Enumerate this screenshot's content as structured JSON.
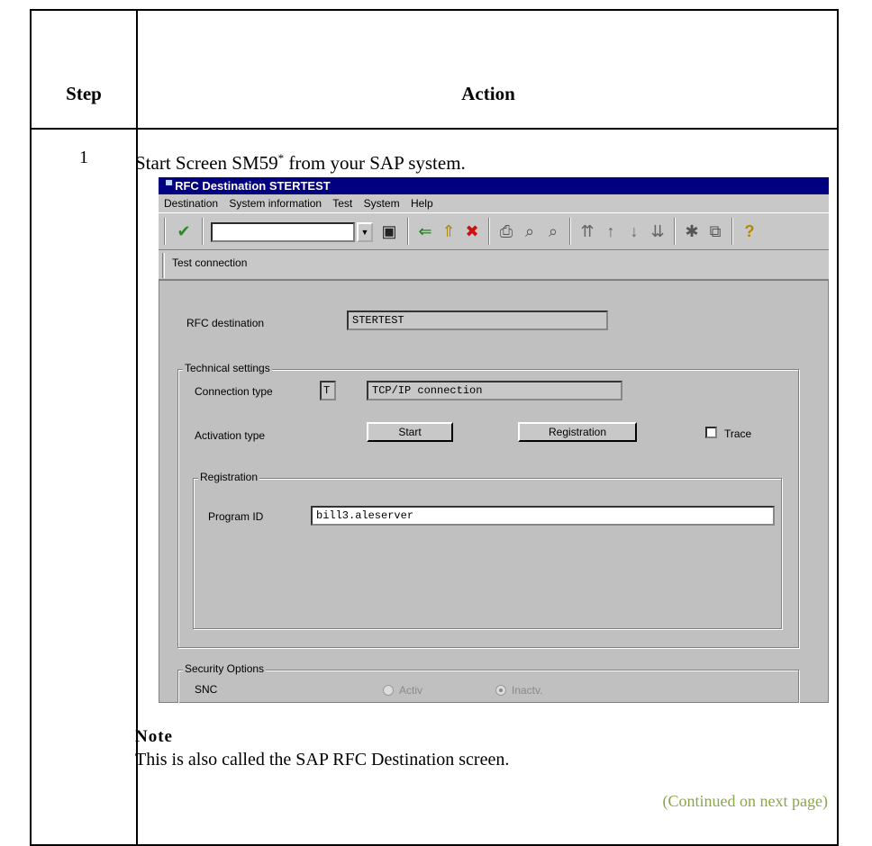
{
  "table": {
    "header_step": "Step",
    "header_action": "Action",
    "step_number": "1",
    "instruction_prefix": "Start Screen SM59",
    "instruction_mark": "*",
    "instruction_suffix": " from your SAP system."
  },
  "sap": {
    "window_title": "RFC Destination STERTEST",
    "menu": [
      "Destination",
      "System information",
      "Test",
      "System",
      "Help"
    ],
    "command_field_value": "",
    "toolbar_icons": [
      "check-icon",
      "save-icon",
      "back-icon",
      "exit-icon",
      "cancel-icon",
      "print-icon",
      "find-icon",
      "find-next-icon",
      "first-page-icon",
      "prev-page-icon",
      "next-page-icon",
      "last-page-icon",
      "create-session-icon",
      "shortcut-icon",
      "help-icon"
    ],
    "app_toolbar_button": "Test connection",
    "rfc_destination_label": "RFC destination",
    "rfc_destination_value": "STERTEST",
    "technical_settings_title": "Technical settings",
    "connection_type_label": "Connection type",
    "connection_type_code": "T",
    "connection_type_desc": "TCP/IP connection",
    "activation_type_label": "Activation type",
    "start_button": "Start",
    "registration_button": "Registration",
    "trace_label": "Trace",
    "trace_checked": false,
    "registration_group_title": "Registration",
    "program_id_label": "Program ID",
    "program_id_value": "bill3.aleserver",
    "security_options_title": "Security Options",
    "snc_label": "SNC",
    "snc_active_label": "Activ",
    "snc_inactive_label": "Inactv.",
    "snc_selected": "Inactv."
  },
  "note": {
    "heading": "Note",
    "text": "This is also called the SAP RFC Destination screen."
  },
  "continued": "(Continued on next page)",
  "colors": {
    "title_bar": "#000080",
    "sap_gray": "#c8c8c8",
    "continued_text": "#8aa64a"
  }
}
